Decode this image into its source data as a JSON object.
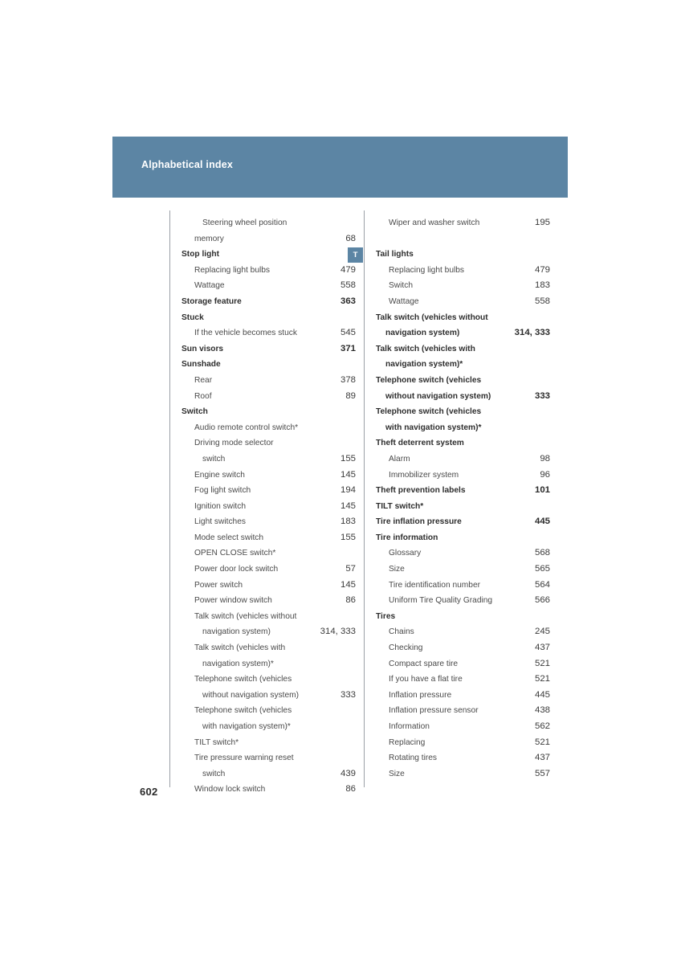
{
  "header": {
    "title": "Alphabetical index"
  },
  "letter_tab": {
    "letter": "T"
  },
  "page_number": "602",
  "columns": {
    "left": [
      {
        "level": "cont2",
        "text": "Steering wheel position",
        "page": "",
        "leader": false
      },
      {
        "level": "lvl2",
        "text": "memory",
        "page": "68",
        "leader": true
      },
      {
        "level": "lvl1",
        "text": "Stop light",
        "page": "",
        "leader": false
      },
      {
        "level": "lvl2",
        "text": "Replacing light bulbs",
        "page": "479",
        "leader": true
      },
      {
        "level": "lvl2",
        "text": "Wattage",
        "page": "558",
        "leader": true
      },
      {
        "level": "lvl1",
        "text": "Storage feature",
        "page": "363",
        "leader": true
      },
      {
        "level": "lvl1",
        "text": "Stuck",
        "page": "",
        "leader": false
      },
      {
        "level": "lvl2",
        "text": "If the vehicle becomes stuck",
        "page": "545",
        "leader": true
      },
      {
        "level": "lvl1",
        "text": "Sun visors",
        "page": "371",
        "leader": true
      },
      {
        "level": "lvl1",
        "text": "Sunshade",
        "page": "",
        "leader": false
      },
      {
        "level": "lvl2",
        "text": "Rear",
        "page": "378",
        "leader": true
      },
      {
        "level": "lvl2",
        "text": "Roof",
        "page": "89",
        "leader": true
      },
      {
        "level": "lvl1",
        "text": "Switch",
        "page": "",
        "leader": false
      },
      {
        "level": "lvl2",
        "text": "Audio remote control switch*",
        "page": "",
        "leader": false
      },
      {
        "level": "lvl2",
        "text": "Driving mode selector",
        "page": "",
        "leader": false
      },
      {
        "level": "cont2",
        "text": "switch",
        "page": "155",
        "leader": true
      },
      {
        "level": "lvl2",
        "text": "Engine switch",
        "page": "145",
        "leader": true
      },
      {
        "level": "lvl2",
        "text": "Fog light switch",
        "page": "194",
        "leader": true
      },
      {
        "level": "lvl2",
        "text": "Ignition switch",
        "page": "145",
        "leader": true
      },
      {
        "level": "lvl2",
        "text": "Light switches",
        "page": "183",
        "leader": true
      },
      {
        "level": "lvl2",
        "text": "Mode select switch",
        "page": "155",
        "leader": true
      },
      {
        "level": "lvl2",
        "text": "OPEN CLOSE switch*",
        "page": "",
        "leader": false
      },
      {
        "level": "lvl2",
        "text": "Power door lock switch",
        "page": "57",
        "leader": true
      },
      {
        "level": "lvl2",
        "text": "Power switch",
        "page": "145",
        "leader": true
      },
      {
        "level": "lvl2",
        "text": "Power window switch",
        "page": "86",
        "leader": true
      },
      {
        "level": "lvl2",
        "text": "Talk switch (vehicles without",
        "page": "",
        "leader": false
      },
      {
        "level": "cont2",
        "text": "navigation system)",
        "page": "314,  333",
        "leader": true
      },
      {
        "level": "lvl2",
        "text": "Talk switch (vehicles with",
        "page": "",
        "leader": false
      },
      {
        "level": "cont2",
        "text": "navigation system)*",
        "page": "",
        "leader": false
      },
      {
        "level": "lvl2",
        "text": "Telephone switch (vehicles",
        "page": "",
        "leader": false
      },
      {
        "level": "cont2",
        "text": "without navigation system)",
        "page": "333",
        "leader": true
      },
      {
        "level": "lvl2",
        "text": "Telephone switch (vehicles",
        "page": "",
        "leader": false
      },
      {
        "level": "cont2",
        "text": "with navigation system)*",
        "page": "",
        "leader": false
      },
      {
        "level": "lvl2",
        "text": "TILT switch*",
        "page": "",
        "leader": false
      },
      {
        "level": "lvl2",
        "text": "Tire pressure warning reset",
        "page": "",
        "leader": false
      },
      {
        "level": "cont2",
        "text": "switch",
        "page": "439",
        "leader": true
      },
      {
        "level": "lvl2",
        "text": "Window lock switch",
        "page": "86",
        "leader": true
      }
    ],
    "right": [
      {
        "level": "lvl2",
        "text": "Wiper and washer switch",
        "page": "195",
        "leader": true
      },
      {
        "level": "spacer",
        "text": "",
        "page": "",
        "leader": false
      },
      {
        "level": "lvl1",
        "text": "Tail lights",
        "page": "",
        "leader": false
      },
      {
        "level": "lvl2",
        "text": "Replacing light bulbs",
        "page": "479",
        "leader": true
      },
      {
        "level": "lvl2",
        "text": "Switch",
        "page": "183",
        "leader": true
      },
      {
        "level": "lvl2",
        "text": "Wattage",
        "page": "558",
        "leader": true
      },
      {
        "level": "lvl1",
        "text": "Talk switch (vehicles without",
        "page": "",
        "leader": false
      },
      {
        "level": "cont1",
        "text": "navigation system)",
        "page": "314, 333",
        "leader": true
      },
      {
        "level": "lvl1",
        "text": "Talk switch (vehicles with",
        "page": "",
        "leader": false
      },
      {
        "level": "cont1",
        "text": "navigation system)*",
        "page": "",
        "leader": false
      },
      {
        "level": "lvl1",
        "text": "Telephone switch (vehicles",
        "page": "",
        "leader": false
      },
      {
        "level": "cont1",
        "text": "without navigation system)",
        "page": "333",
        "leader": true
      },
      {
        "level": "lvl1",
        "text": "Telephone switch (vehicles",
        "page": "",
        "leader": false
      },
      {
        "level": "cont1",
        "text": "with navigation system)*",
        "page": "",
        "leader": false
      },
      {
        "level": "lvl1",
        "text": "Theft deterrent system",
        "page": "",
        "leader": false
      },
      {
        "level": "lvl2",
        "text": "Alarm",
        "page": "98",
        "leader": true
      },
      {
        "level": "lvl2",
        "text": "Immobilizer system",
        "page": "96",
        "leader": true
      },
      {
        "level": "lvl1",
        "text": "Theft prevention labels",
        "page": "101",
        "leader": true
      },
      {
        "level": "lvl1",
        "text": "TILT switch*",
        "page": "",
        "leader": false
      },
      {
        "level": "lvl1",
        "text": "Tire inflation pressure",
        "page": "445",
        "leader": true
      },
      {
        "level": "lvl1",
        "text": "Tire information",
        "page": "",
        "leader": false
      },
      {
        "level": "lvl2",
        "text": "Glossary",
        "page": "568",
        "leader": true
      },
      {
        "level": "lvl2",
        "text": "Size",
        "page": "565",
        "leader": true
      },
      {
        "level": "lvl2",
        "text": "Tire identification number",
        "page": "564",
        "leader": true
      },
      {
        "level": "lvl2",
        "text": "Uniform Tire Quality Grading",
        "page": "566",
        "leader": true
      },
      {
        "level": "lvl1",
        "text": "Tires",
        "page": "",
        "leader": false
      },
      {
        "level": "lvl2",
        "text": "Chains",
        "page": "245",
        "leader": true
      },
      {
        "level": "lvl2",
        "text": "Checking",
        "page": "437",
        "leader": true
      },
      {
        "level": "lvl2",
        "text": "Compact spare tire",
        "page": "521",
        "leader": true
      },
      {
        "level": "lvl2",
        "text": "If you have a flat tire",
        "page": "521",
        "leader": true
      },
      {
        "level": "lvl2",
        "text": "Inflation pressure",
        "page": "445",
        "leader": true
      },
      {
        "level": "lvl2",
        "text": "Inflation pressure sensor",
        "page": "438",
        "leader": true
      },
      {
        "level": "lvl2",
        "text": "Information",
        "page": "562",
        "leader": true
      },
      {
        "level": "lvl2",
        "text": "Replacing",
        "page": "521",
        "leader": true
      },
      {
        "level": "lvl2",
        "text": "Rotating tires",
        "page": "437",
        "leader": true
      },
      {
        "level": "lvl2",
        "text": "Size",
        "page": "557",
        "leader": true
      }
    ]
  },
  "colors": {
    "banner": "#5c85a4",
    "tab": "#5c85a4",
    "text": "#3b3b3b",
    "rule": "#9aa0a6"
  }
}
